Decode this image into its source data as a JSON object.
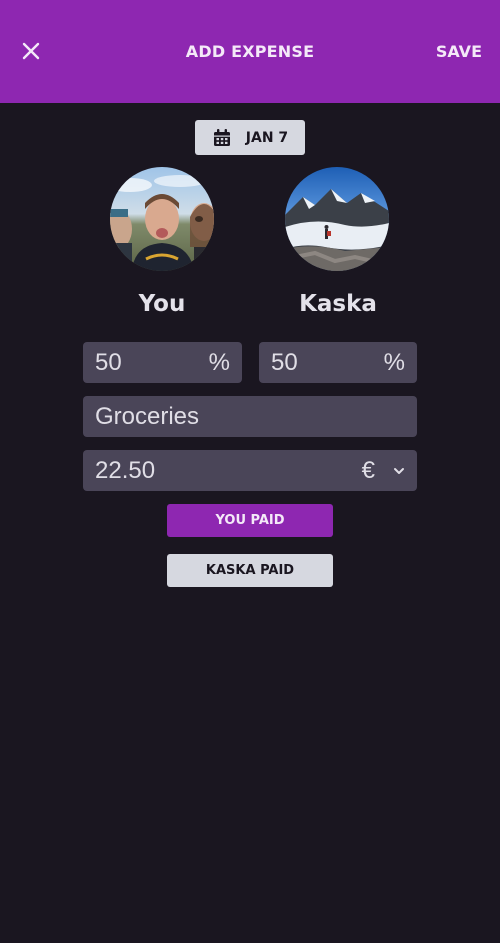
{
  "header": {
    "title": "ADD EXPENSE",
    "save_label": "SAVE",
    "close_icon": "close-icon"
  },
  "date": {
    "label": "JAN 7",
    "icon": "calendar-icon"
  },
  "people": [
    {
      "name": "You"
    },
    {
      "name": "Kaska"
    }
  ],
  "split": {
    "you_percent": "50",
    "kaska_percent": "50",
    "unit": "%"
  },
  "description": {
    "value": "Groceries"
  },
  "amount": {
    "value": "22.50",
    "currency": "€",
    "currency_dropdown_icon": "chevron-down-icon"
  },
  "payer_buttons": {
    "you_paid": "YOU PAID",
    "kaska_paid": "KASKA PAID"
  },
  "colors": {
    "accent": "#8e27b1",
    "background": "#1a1620",
    "field": "#4a4558",
    "light_button": "#d6d8e0"
  }
}
